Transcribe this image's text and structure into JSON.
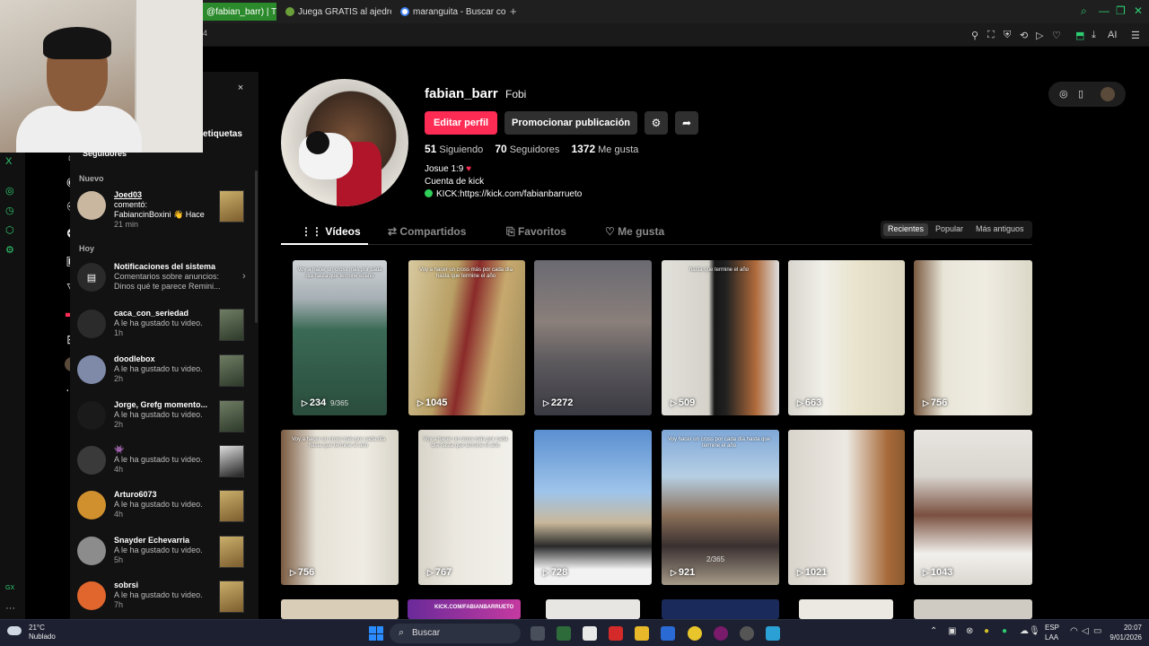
{
  "browser": {
    "tabs": [
      {
        "label": "@fabian_barr) | TikT",
        "active": true
      },
      {
        "label": "Juega GRATIS al ajedrez c",
        "active": false
      },
      {
        "label": "maranguita - Buscar con G",
        "active": false
      }
    ],
    "new_tab": "+",
    "url_fragment": "4"
  },
  "left_rail": {
    "items": [
      "x-icon",
      "circle-icon",
      "clock-icon",
      "puzzle-icon",
      "settings-icon"
    ],
    "bottom_label": "GX"
  },
  "nav": {
    "items": [
      "home-icon",
      "explore-icon",
      "following-icon",
      "friends-icon",
      "live-icon",
      "messages-icon",
      "inbox-icon",
      "upload-icon",
      "profile-icon",
      "more-icon"
    ]
  },
  "notifications": {
    "close": "×",
    "partial_tab": "etiquetas",
    "partial_tab2": "Seguidores",
    "section_new": "Nuevo",
    "section_today": "Hoy",
    "items": [
      {
        "user": "Joed03",
        "text": "comentó:",
        "text2": "FabiancinBoxini 👋 Hace",
        "time": "21 min"
      },
      {
        "user": "Notificaciones del sistema",
        "text": "Comentarios sobre anuncios:",
        "text2": "Dinos qué te parece Remini...",
        "time": ""
      },
      {
        "user": "caca_con_seriedad",
        "text": "A le ha gustado tu video.",
        "time": "1h"
      },
      {
        "user": "doodlebox",
        "text": "A le ha gustado tu video.",
        "time": "2h"
      },
      {
        "user": "Jorge, Grefg momento...",
        "text": "A le ha gustado tu video.",
        "time": "2h"
      },
      {
        "user": "👾",
        "text": "A le ha gustado tu video.",
        "time": "4h"
      },
      {
        "user": "Arturo6073",
        "text": "A le ha gustado tu video.",
        "time": "4h"
      },
      {
        "user": "Snayder Echevarria",
        "text": "A le ha gustado tu video.",
        "time": "5h"
      },
      {
        "user": "sobrsi",
        "text": "A le ha gustado tu video.",
        "time": "7h"
      }
    ]
  },
  "profile": {
    "username": "fabian_barr",
    "nickname": "Fobi",
    "edit_button": "Editar perfil",
    "promote_button": "Promocionar publicación",
    "stats": [
      {
        "value": "51",
        "label": "Siguiendo"
      },
      {
        "value": "70",
        "label": "Seguidores"
      },
      {
        "value": "1372",
        "label": "Me gusta"
      }
    ],
    "bio": [
      "Josue 1:9",
      "Cuenta de kick",
      "KICK:https://kick.com/fabianbarrueto"
    ]
  },
  "tabs": [
    {
      "label": "Vídeos",
      "icon": "grid-icon",
      "active": true
    },
    {
      "label": "Compartidos",
      "icon": "repost-icon",
      "active": false
    },
    {
      "label": "Favoritos",
      "icon": "bookmark-icon",
      "active": false
    },
    {
      "label": "Me gusta",
      "icon": "heart-outline-icon",
      "active": false
    }
  ],
  "sort": [
    {
      "label": "Recientes",
      "active": true
    },
    {
      "label": "Popular",
      "active": false
    },
    {
      "label": "Más antiguos",
      "active": false
    }
  ],
  "videos": [
    {
      "views": "234",
      "sub": "9/365",
      "caption": "Voy a hacer un cross más por cada día hasta que termine el año"
    },
    {
      "views": "1045",
      "sub": "",
      "caption": "Voy a hacer un cross más por cada día hasta que termine el año"
    },
    {
      "views": "2272",
      "sub": "",
      "caption": ""
    },
    {
      "views": "509",
      "sub": "",
      "caption": "hasta que termine el año"
    },
    {
      "views": "663",
      "sub": "",
      "caption": ""
    },
    {
      "views": "756",
      "sub": "",
      "caption": ""
    },
    {
      "views": "756",
      "sub": "",
      "caption": "Voy a hacer un cross más por cada día hasta que termine el año"
    },
    {
      "views": "767",
      "sub": "",
      "caption": "Voy a hacer un cross más por cada día hasta que termine el año"
    },
    {
      "views": "728",
      "sub": "",
      "caption": ""
    },
    {
      "views": "921",
      "sub": "2/365",
      "caption": "Voy hacer un cross por cada día hasta que termine el año"
    },
    {
      "views": "1021",
      "sub": "",
      "caption": ""
    },
    {
      "views": "1043",
      "sub": "",
      "caption": ""
    }
  ],
  "row3_caption": "KICK.COM/FABIANBARRUETO",
  "taskbar": {
    "temp": "21°C",
    "weather": "Nublado",
    "search": "Buscar",
    "lang1": "ESP",
    "lang2": "LAA",
    "time": "20:07",
    "date": "9/01/2026"
  }
}
